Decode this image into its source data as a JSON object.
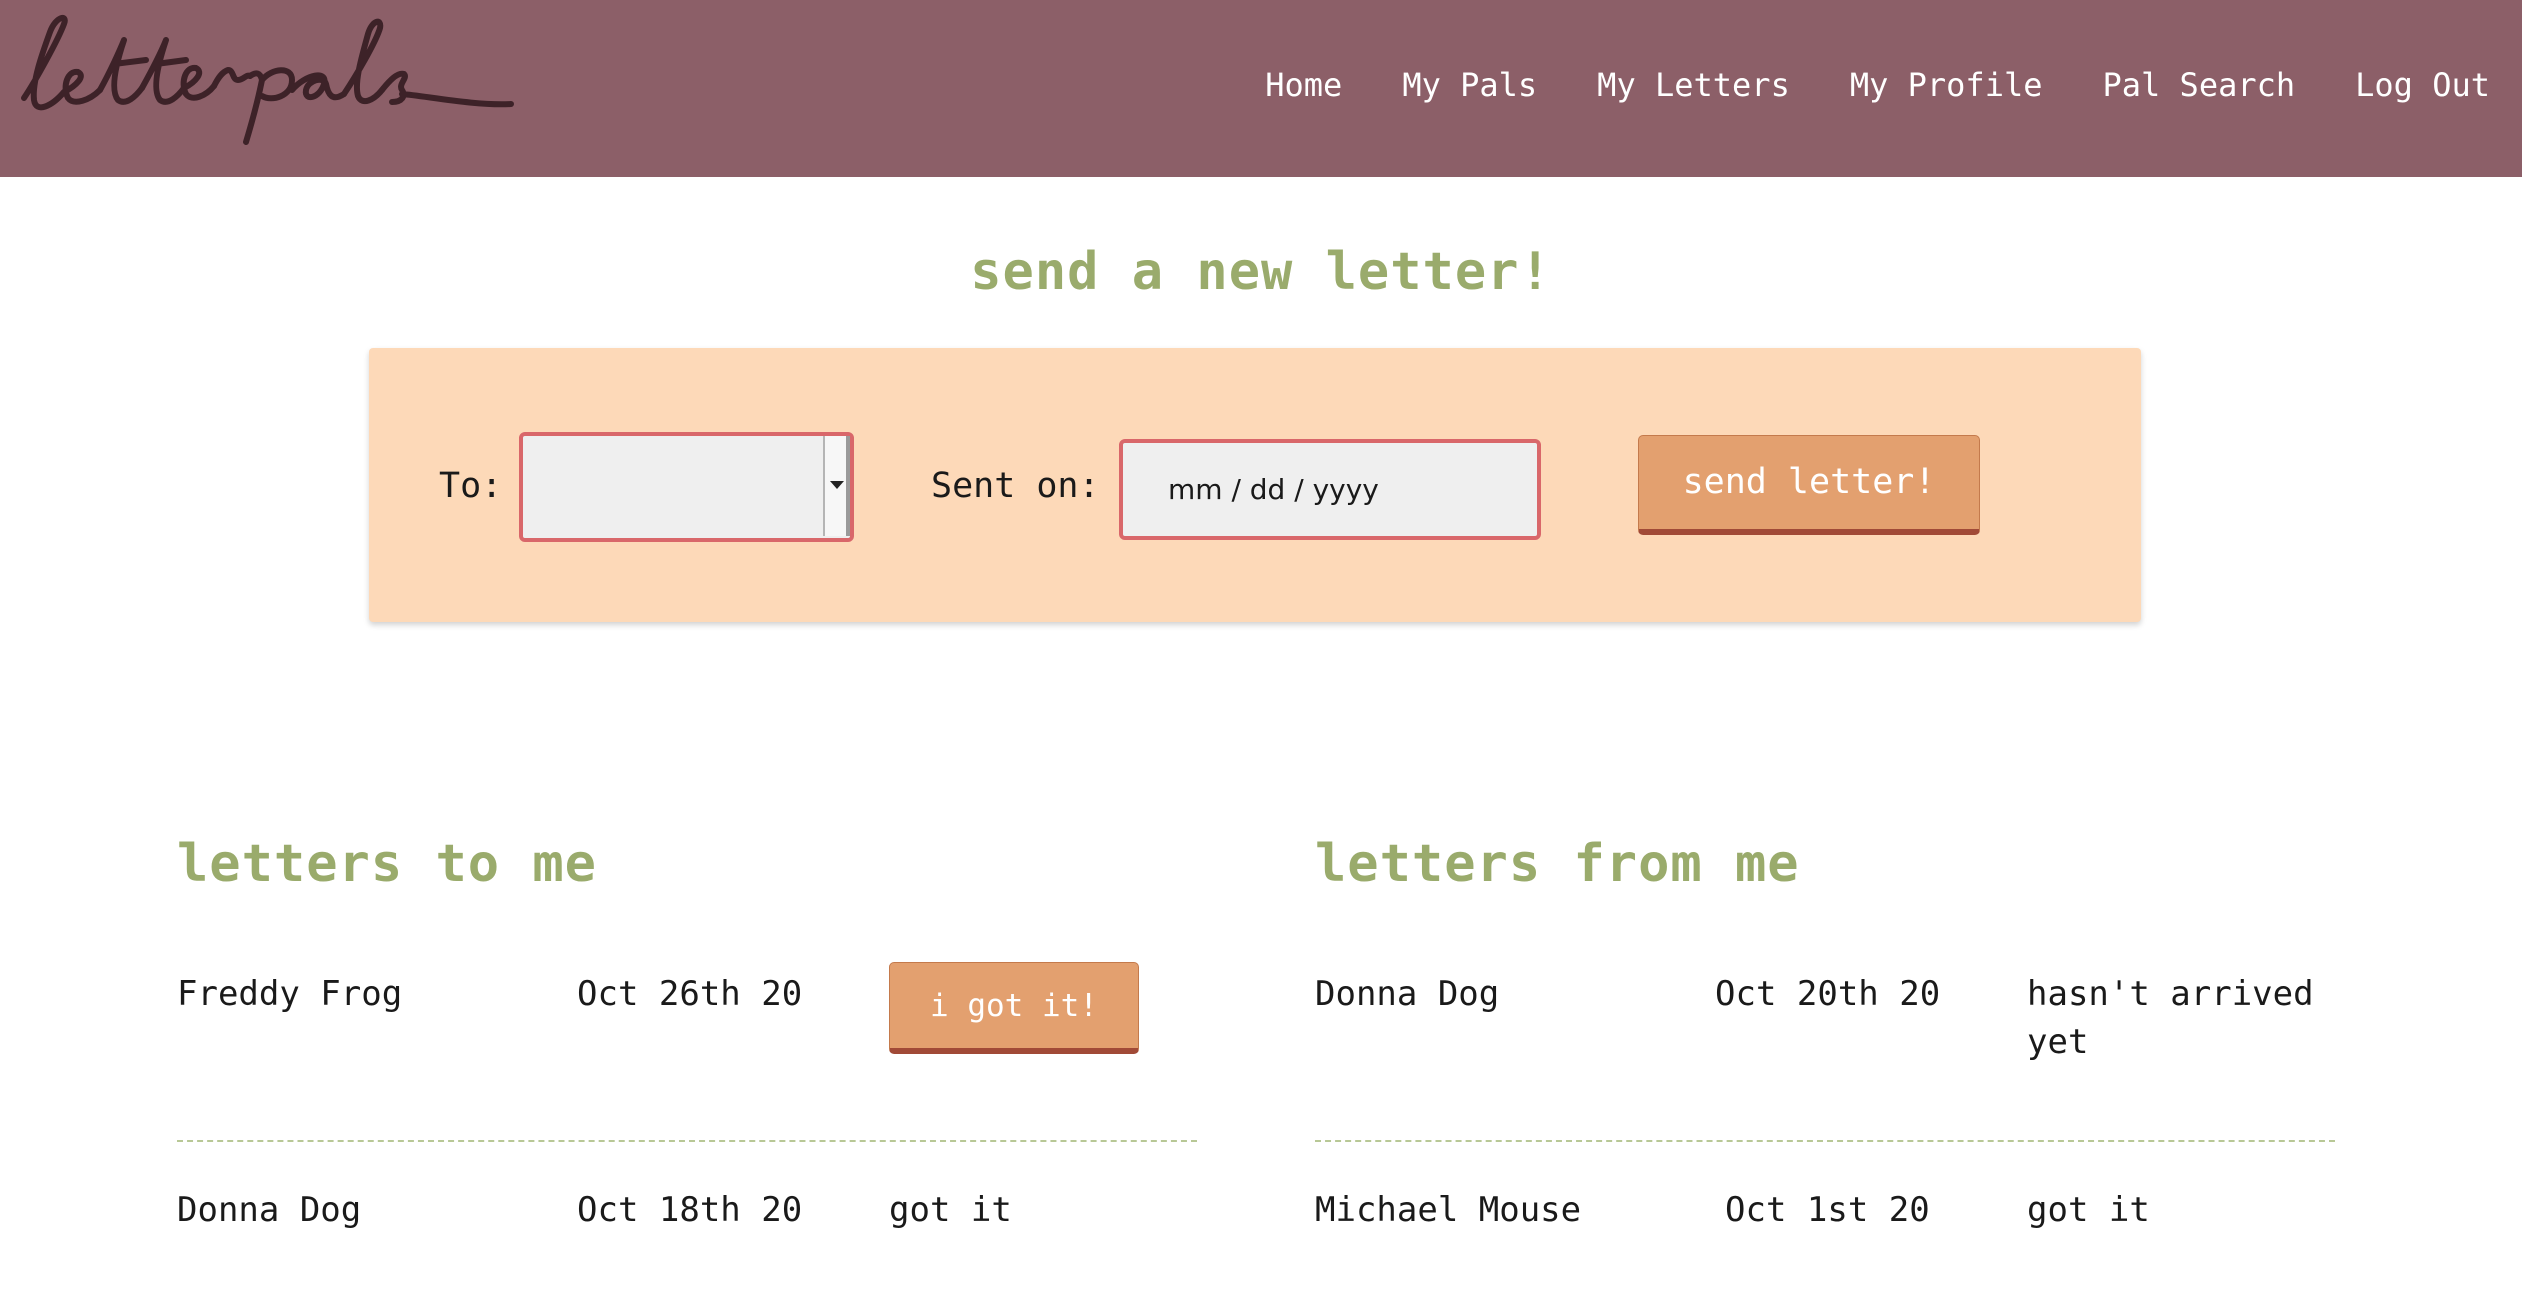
{
  "header": {
    "logo_text": "letterpals",
    "nav": [
      "Home",
      "My Pals",
      "My Letters",
      "My Profile",
      "Pal Search",
      "Log Out"
    ]
  },
  "compose": {
    "title": "send a new letter!",
    "to_label": "To:",
    "to_value": "",
    "sent_label": "Sent on:",
    "date_placeholder": "mm / dd / yyyy",
    "send_button": "send letter!"
  },
  "letters_to_me": {
    "title": "letters to me",
    "rows": [
      {
        "name": "Freddy Frog",
        "date": "Oct 26th 20",
        "action": "i got it!"
      },
      {
        "name": "Donna Dog",
        "date": "Oct 18th 20",
        "status": "got it"
      }
    ]
  },
  "letters_from_me": {
    "title": "letters from me",
    "rows": [
      {
        "name": "Donna Dog",
        "date": "Oct 20th 20",
        "status": "hasn't arrived yet"
      },
      {
        "name": "Michael Mouse",
        "date": "Oct 1st 20",
        "status": "got it"
      }
    ]
  },
  "colors": {
    "header_bg": "#8c5f68",
    "accent_green": "#9aab6c",
    "card_bg": "#fdd9b8",
    "button_bg": "#e3a06f",
    "input_border": "#d9676a"
  }
}
